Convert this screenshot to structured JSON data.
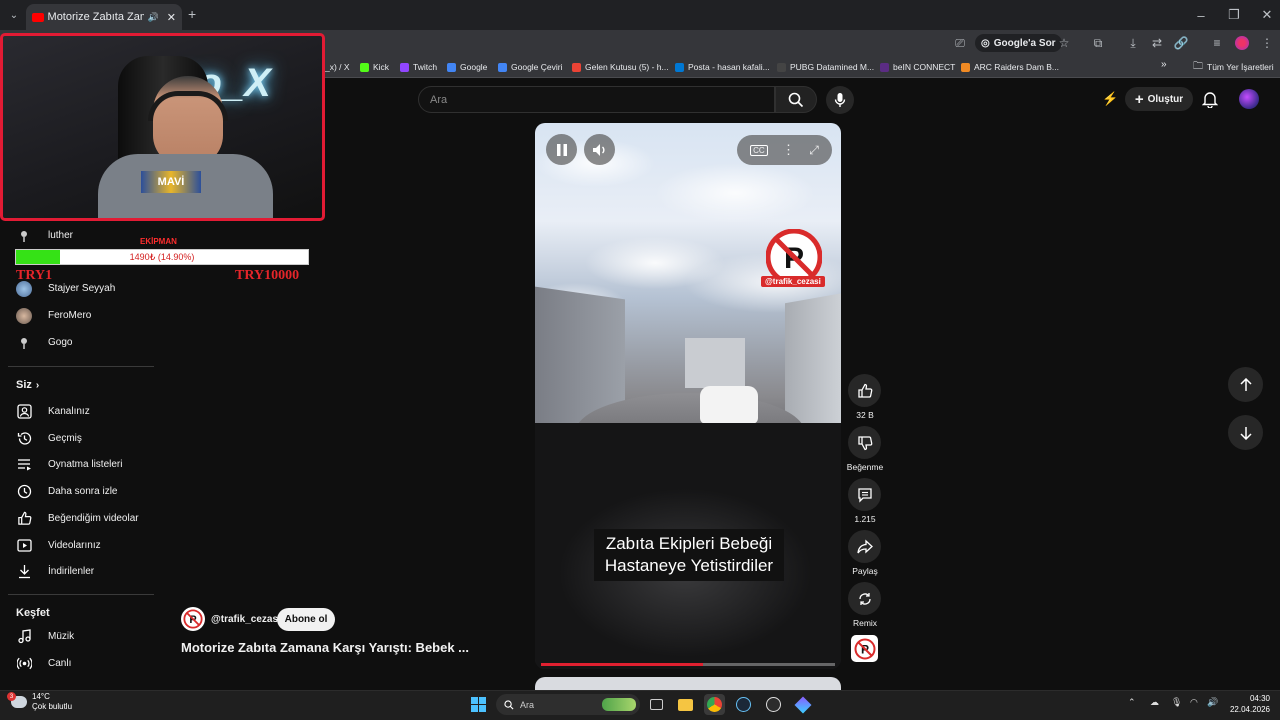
{
  "browser": {
    "tab_title": "Motorize Zabıta Zamana Ka...",
    "google_sor": "Google'a Sor",
    "bookmarks": [
      {
        "label": "_x) / X",
        "color": "#000000"
      },
      {
        "label": "Kick",
        "color": "#53fc18"
      },
      {
        "label": "Twitch",
        "color": "#9146ff"
      },
      {
        "label": "Google",
        "color": "#4285f4"
      },
      {
        "label": "Google Çeviri",
        "color": "#4285f4"
      },
      {
        "label": "Gelen Kutusu (5) - h...",
        "color": "#ea4335"
      },
      {
        "label": "Posta - hasan kafali...",
        "color": "#0078d4"
      },
      {
        "label": "PUBG Datamined M...",
        "color": "#444444"
      },
      {
        "label": "beIN CONNECT",
        "color": "#5b2c83"
      },
      {
        "label": "ARC Raiders Dam B...",
        "color": "#f08a24"
      }
    ],
    "all_bookmarks": "Tüm Yer İşaretleri"
  },
  "youtube": {
    "search_placeholder": "Ara",
    "create_label": "Oluştur"
  },
  "webcam": {
    "neon_text": "no_X"
  },
  "donation": {
    "title": "EKİPMAN",
    "progress_text": "1490₺ (14.90%)",
    "progress": 0.149,
    "min_label": "TRY1",
    "max_label": "TRY10000"
  },
  "sidebar": {
    "subscriptions": [
      {
        "label": "luther",
        "icon": "antenna-icon"
      },
      {
        "label": "Stajyer Seyyah",
        "icon": "avatar"
      },
      {
        "label": "FeroMero",
        "icon": "avatar"
      },
      {
        "label": "Gogo",
        "icon": "avatar"
      }
    ],
    "you_heading": "Siz",
    "you_items": [
      {
        "label": "Kanalınız",
        "icon": "channel-icon"
      },
      {
        "label": "Geçmiş",
        "icon": "history-icon"
      },
      {
        "label": "Oynatma listeleri",
        "icon": "playlist-icon"
      },
      {
        "label": "Daha sonra izle",
        "icon": "clock-icon"
      },
      {
        "label": "Beğendiğim videolar",
        "icon": "thumbs-up-icon"
      },
      {
        "label": "Videolarınız",
        "icon": "video-icon"
      },
      {
        "label": "İndirilenler",
        "icon": "download-icon"
      }
    ],
    "explore_heading": "Keşfet",
    "explore_items": [
      {
        "label": "Müzik",
        "icon": "music-icon"
      },
      {
        "label": "Canlı",
        "icon": "live-icon"
      }
    ]
  },
  "video": {
    "logo_handle": "@trafik_cezasi",
    "caption_line1": "Zabıta Ekipleri Bebeği",
    "caption_line2": "Hastaneye Yetistirdiler",
    "progress": 0.55,
    "channel": "@trafik_cezasi",
    "subscribe_label": "Abone ol",
    "title": "Motorize Zabıta Zamana Karşı Yarıştı: Bebek ..."
  },
  "actions": {
    "likes": "32 B",
    "dislike_label": "Beğenme",
    "comments": "1.215",
    "share_label": "Paylaş",
    "remix_label": "Remix"
  },
  "taskbar": {
    "temp": "14°C",
    "weather": "Çok bulutlu",
    "weather_badge": "3",
    "search_placeholder": "Ara",
    "time": "04:30",
    "date": "22.04.2026"
  }
}
